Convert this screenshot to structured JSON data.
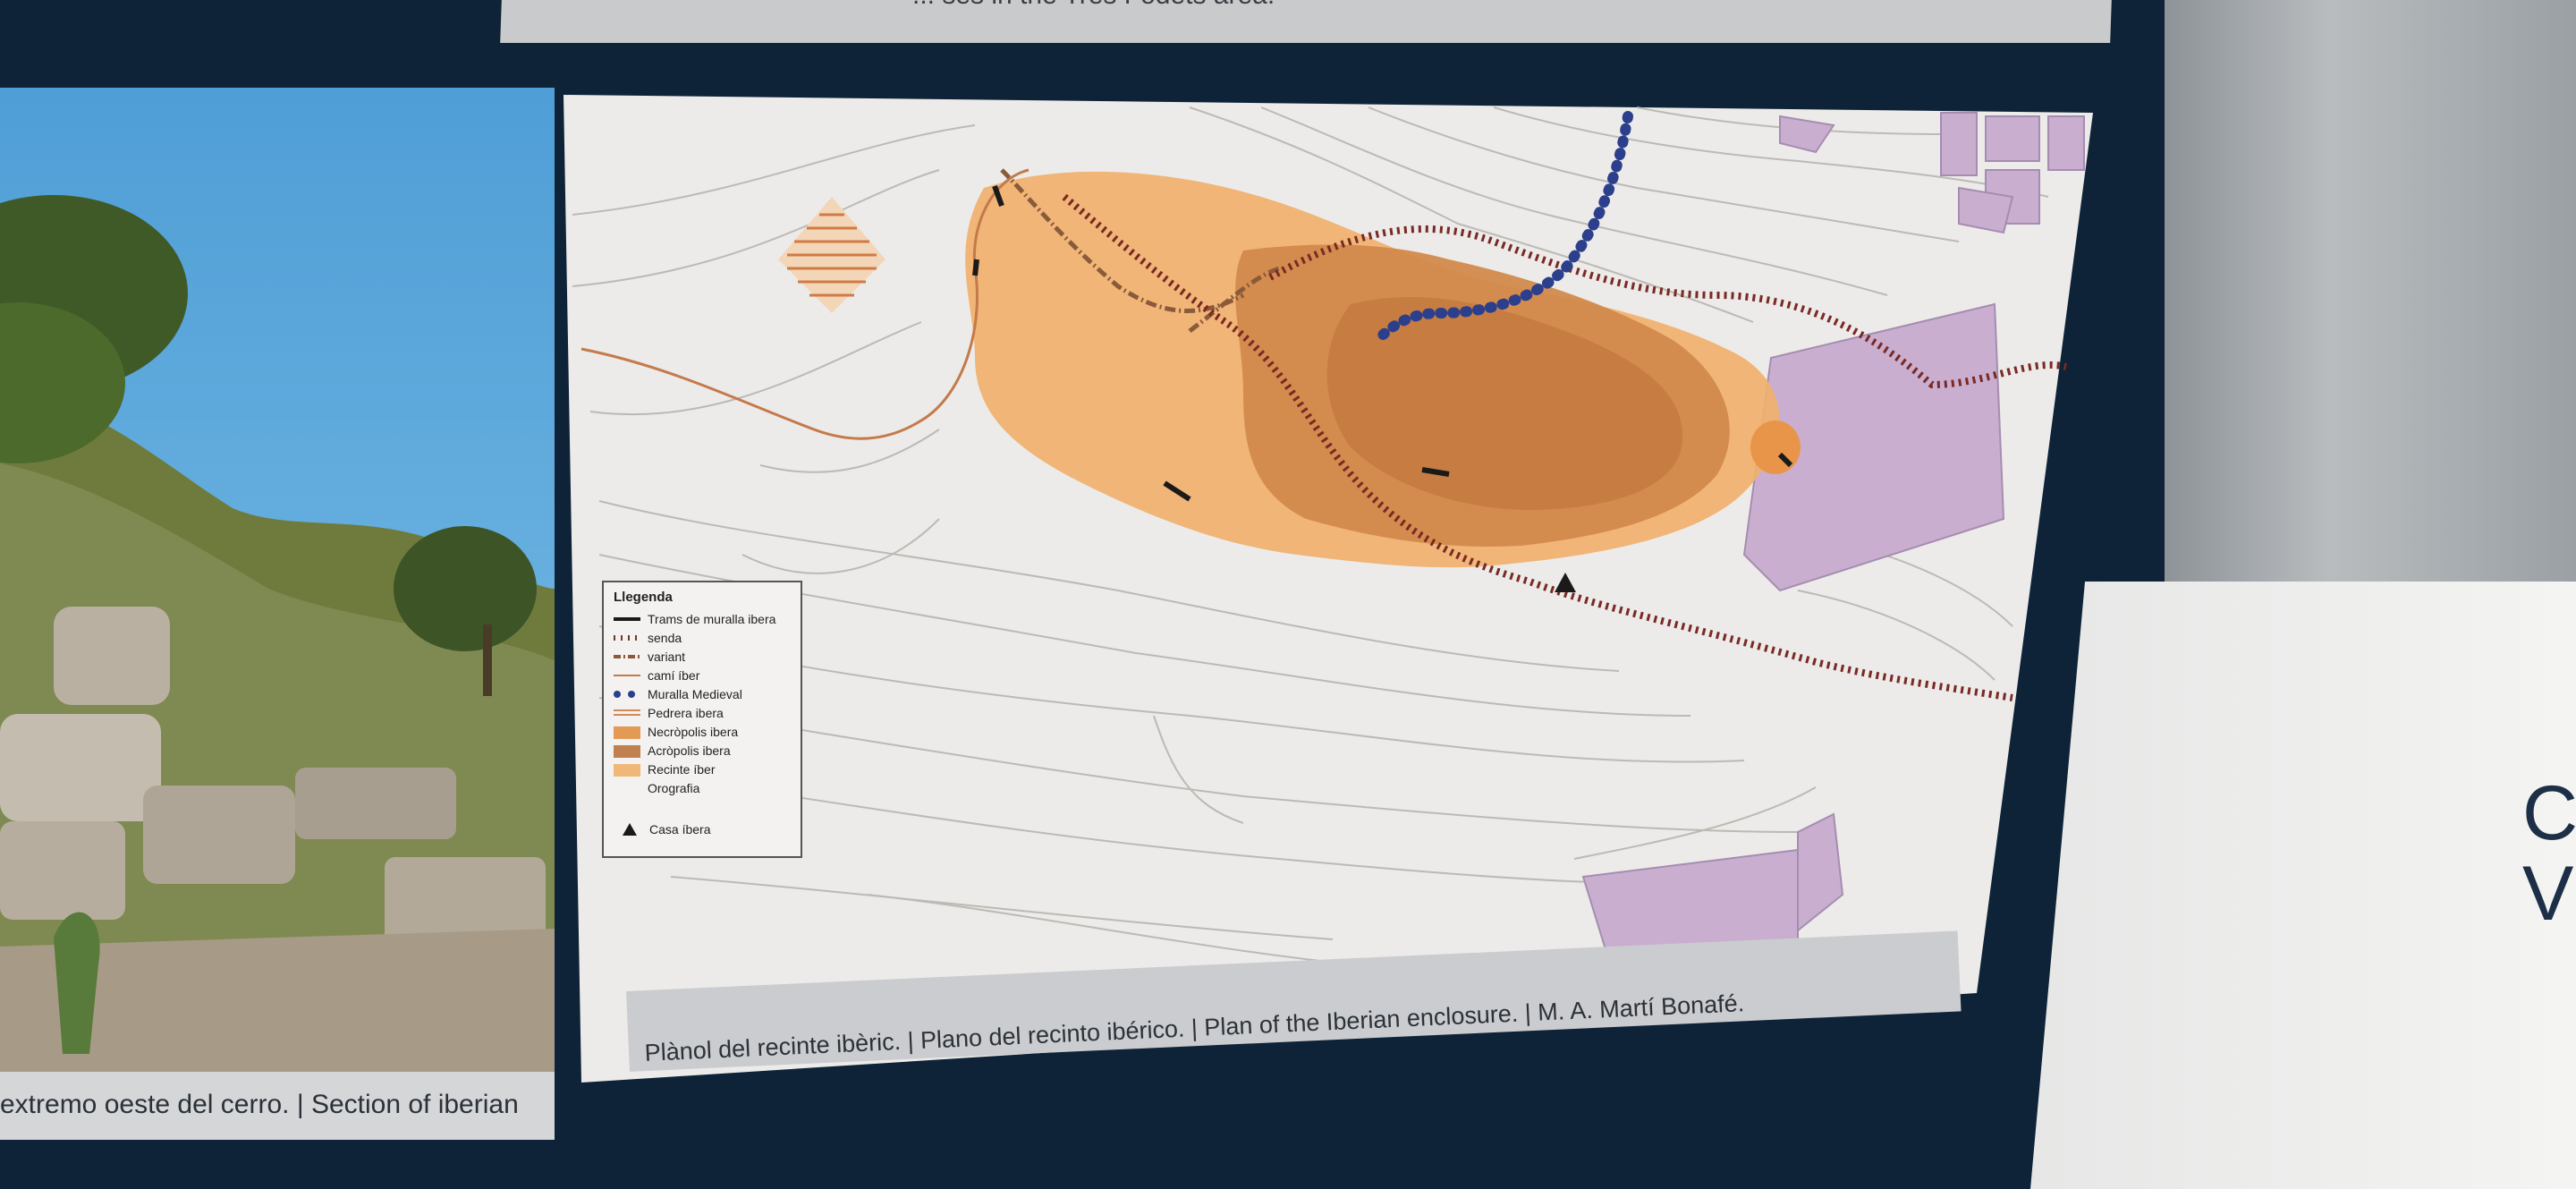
{
  "scene": {
    "top_caption": "... ses in the Tres Fodets area.",
    "right_wall_text_line1": "C",
    "right_wall_text_line2": "VI"
  },
  "photo_panel": {
    "caption": "extremo oeste del cerro. | Section of iberian"
  },
  "map_panel": {
    "caption": "Plànol del recinte ibèric. | Plano del recinto ibérico. | Plan of the Iberian enclosure. | M. A. Martí Bonafé.",
    "legend": {
      "title": "Llegenda",
      "items": [
        {
          "label": "Trams de muralla ibera",
          "symbol": "solid-line",
          "color": "#1a1a1a"
        },
        {
          "label": "senda",
          "symbol": "tick-line",
          "color": "#6b3a2a"
        },
        {
          "label": "variant",
          "symbol": "dash-dot-line",
          "color": "#8a5a3a"
        },
        {
          "label": "camí íber",
          "symbol": "thin-line",
          "color": "#c47a4a"
        },
        {
          "label": "Muralla Medieval",
          "symbol": "dots",
          "color": "#2c3f8c"
        },
        {
          "label": "Pedrera ibera",
          "symbol": "hatch",
          "color": "#d08a5a"
        },
        {
          "label": "Necròpolis ibera",
          "symbol": "fill",
          "color": "#e29a55"
        },
        {
          "label": "Acròpolis ibera",
          "symbol": "fill",
          "color": "#c08050"
        },
        {
          "label": "Recinte íber",
          "symbol": "fill",
          "color": "#f0b878"
        },
        {
          "label": "Orografia",
          "symbol": "none",
          "color": "#bbbbbb"
        },
        {
          "label": "Casa íbera",
          "symbol": "triangle",
          "color": "#1a1a1a"
        }
      ]
    },
    "colors": {
      "recinte": "#f0b06c",
      "acropolis": "#d28a4c",
      "acropolis_core": "#c47a40",
      "modern_buildings": "#c9aed0",
      "muralla_medieval": "#2c3f8c",
      "senda": "#7a2a24",
      "contours": "#b9b6b2",
      "map_bg": "#ececea"
    }
  }
}
